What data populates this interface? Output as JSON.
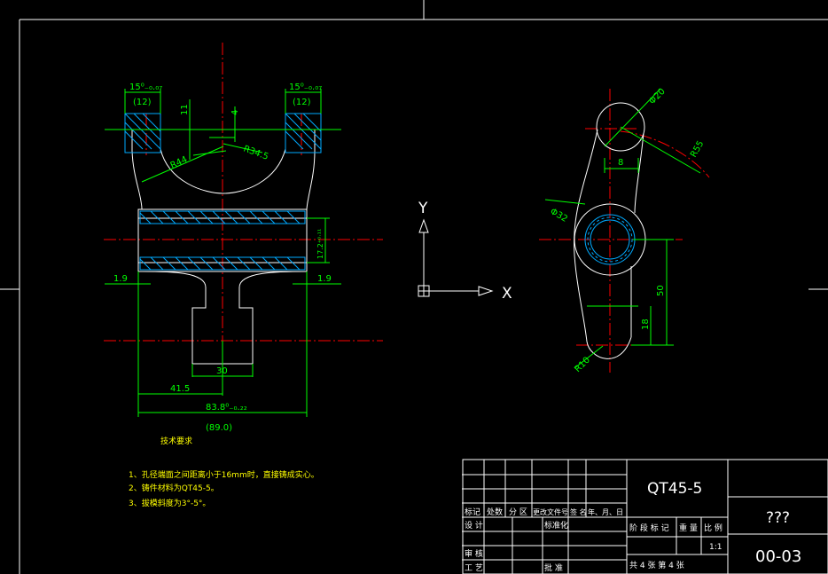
{
  "colors": {
    "background": "#000000",
    "outline": "#ffffff",
    "dimension": "#00ff00",
    "centerline": "#ff0000",
    "hatch": "#00aaff",
    "note_text": "#ffff00"
  },
  "left_view": {
    "dims": {
      "tol_left": "15⁰₋₀.₀₇",
      "tol_right": "15⁰₋₀.₀₇",
      "ref_left": "(12)",
      "ref_right": "(12)",
      "d11": "11",
      "d4": "4",
      "r44": "R44",
      "r345": "R34.5",
      "d19_left": "1.9",
      "d19_right": "1.9",
      "d30": "30",
      "d415": "41.5",
      "d838": "83.8⁰₋₀.₂₂",
      "d838_ref": "(89.0)",
      "bore": "17.2⁺⁰·¹¹"
    }
  },
  "axes_icon": {
    "y": "Y",
    "x": "X"
  },
  "right_view": {
    "dims": {
      "phi20": "Φ20",
      "phi32": "Φ32",
      "r55": "R55",
      "d8": "8",
      "d50": "50",
      "d18": "18",
      "r10": "R10"
    }
  },
  "notes": {
    "title": "技术要求",
    "items": [
      "1、孔径端面之间距离小于16mm时，直接铸成实心。",
      "2、铸件材料为QT45-5。",
      "3、拔模斜度为3°-5°。"
    ]
  },
  "title_block": {
    "material": "QT45-5",
    "name": "???",
    "code": "00-03",
    "scale": "1:1",
    "row_labels": [
      "标记",
      "处数",
      "分 区",
      "更改文件号",
      "签 名",
      "年、月、日"
    ],
    "designer": "设 计",
    "standard": "标准化",
    "review": "审 核",
    "process": "工 艺",
    "approve": "批 准",
    "stage_labels": [
      "阶 段 标 记",
      "重 量",
      "比 例"
    ],
    "sheets": "共  4  张    第  4  张"
  }
}
